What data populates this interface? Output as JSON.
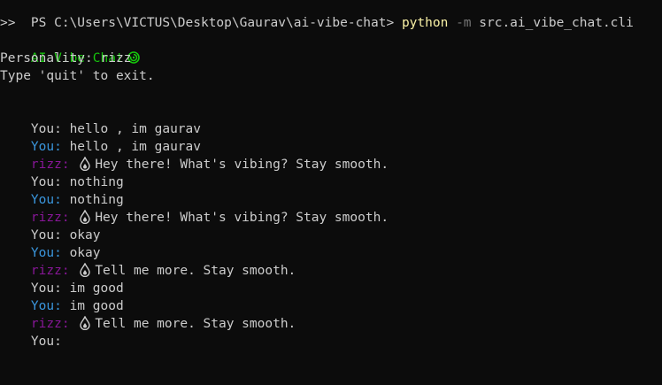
{
  "prompt": {
    "path": "PS C:\\Users\\VICTUS\\Desktop\\Gaurav\\ai-vibe-chat> ",
    "python": "python",
    "flag": " -m ",
    "module": "src.ai_vibe_chat.cli"
  },
  "continuation": ">>",
  "title": "AI Vibe Chat",
  "title_icon": "spiral-icon",
  "personality_line": "Personality: rizz",
  "quit_line": "Type 'quit' to exit.",
  "labels": {
    "you_input": "You: ",
    "you_echo": "You: ",
    "bot": "rizz: "
  },
  "messages": [
    {
      "input": "hello , im gaurav",
      "echo": "hello , im gaurav",
      "reply": "Hey there! What's vibing? Stay smooth."
    },
    {
      "input": "nothing",
      "echo": "nothing",
      "reply": "Hey there! What's vibing? Stay smooth."
    },
    {
      "input": "okay",
      "echo": "okay",
      "reply": "Tell me more. Stay smooth."
    },
    {
      "input": "im good",
      "echo": "im good",
      "reply": "Tell me more. Stay smooth."
    }
  ],
  "final_prompt": "You:",
  "reply_icon": "drop-icon",
  "colors": {
    "background": "#0c0c0c",
    "text": "#cccccc",
    "python": "#f9f1a5",
    "flag": "#767676",
    "title": "#16c60c",
    "you_echo": "#3a96dd",
    "bot": "#881798"
  }
}
